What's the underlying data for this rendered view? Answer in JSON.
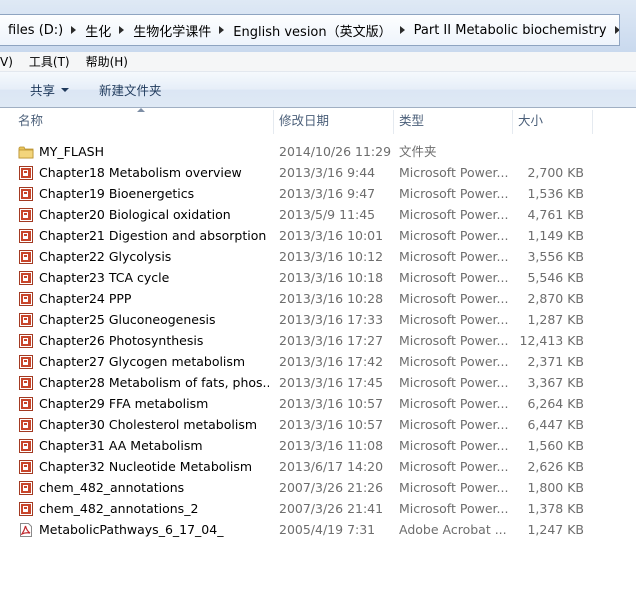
{
  "address_bar": {
    "crumbs": [
      "files (D:)",
      "生化",
      "生物化学课件",
      "English vesion（英文版）",
      "Part II Metabolic biochemistry"
    ]
  },
  "menu": {
    "items": [
      "V)",
      "工具(T)",
      "帮助(H)"
    ]
  },
  "commands": {
    "share_label": "共享",
    "new_folder_label": "新建文件夹"
  },
  "columns": {
    "name": "名称",
    "date": "修改日期",
    "type": "类型",
    "size": "大小"
  },
  "files": [
    {
      "icon": "folder-icon",
      "name": "MY_FLASH",
      "date": "2014/10/26 11:29",
      "type": "文件夹",
      "size": ""
    },
    {
      "icon": "powerpoint-icon",
      "name": "Chapter18 Metabolism overview",
      "date": "2013/3/16 9:44",
      "type": "Microsoft Power...",
      "size": "2,700 KB"
    },
    {
      "icon": "powerpoint-icon",
      "name": "Chapter19 Bioenergetics",
      "date": "2013/3/16 9:47",
      "type": "Microsoft Power...",
      "size": "1,536 KB"
    },
    {
      "icon": "powerpoint-icon",
      "name": "Chapter20 Biological oxidation",
      "date": "2013/5/9 11:45",
      "type": "Microsoft Power...",
      "size": "4,761 KB"
    },
    {
      "icon": "powerpoint-icon",
      "name": "Chapter21 Digestion and absorption ...",
      "date": "2013/3/16 10:01",
      "type": "Microsoft Power...",
      "size": "1,149 KB"
    },
    {
      "icon": "powerpoint-icon",
      "name": "Chapter22 Glycolysis",
      "date": "2013/3/16 10:12",
      "type": "Microsoft Power...",
      "size": "3,556 KB"
    },
    {
      "icon": "powerpoint-icon",
      "name": "Chapter23 TCA cycle",
      "date": "2013/3/16 10:18",
      "type": "Microsoft Power...",
      "size": "5,546 KB"
    },
    {
      "icon": "powerpoint-icon",
      "name": "Chapter24 PPP",
      "date": "2013/3/16 10:28",
      "type": "Microsoft Power...",
      "size": "2,870 KB"
    },
    {
      "icon": "powerpoint-icon",
      "name": "Chapter25 Gluconeogenesis",
      "date": "2013/3/16 17:33",
      "type": "Microsoft Power...",
      "size": "1,287 KB"
    },
    {
      "icon": "powerpoint-icon",
      "name": "Chapter26 Photosynthesis",
      "date": "2013/3/16 17:27",
      "type": "Microsoft Power...",
      "size": "12,413 KB"
    },
    {
      "icon": "powerpoint-icon",
      "name": "Chapter27 Glycogen metabolism",
      "date": "2013/3/16 17:42",
      "type": "Microsoft Power...",
      "size": "2,371 KB"
    },
    {
      "icon": "powerpoint-icon",
      "name": "Chapter28 Metabolism of fats, phos...",
      "date": "2013/3/16 17:45",
      "type": "Microsoft Power...",
      "size": "3,367 KB"
    },
    {
      "icon": "powerpoint-icon",
      "name": "Chapter29 FFA metabolism",
      "date": "2013/3/16 10:57",
      "type": "Microsoft Power...",
      "size": "6,264 KB"
    },
    {
      "icon": "powerpoint-icon",
      "name": "Chapter30 Cholesterol metabolism",
      "date": "2013/3/16 10:57",
      "type": "Microsoft Power...",
      "size": "6,447 KB"
    },
    {
      "icon": "powerpoint-icon",
      "name": "Chapter31 AA Metabolism",
      "date": "2013/3/16 11:08",
      "type": "Microsoft Power...",
      "size": "1,560 KB"
    },
    {
      "icon": "powerpoint-icon",
      "name": "Chapter32 Nucleotide Metabolism",
      "date": "2013/6/17 14:20",
      "type": "Microsoft Power...",
      "size": "2,626 KB"
    },
    {
      "icon": "powerpoint-icon",
      "name": "chem_482_annotations",
      "date": "2007/3/26 21:26",
      "type": "Microsoft Power...",
      "size": "1,800 KB"
    },
    {
      "icon": "powerpoint-icon",
      "name": "chem_482_annotations_2",
      "date": "2007/3/26 21:41",
      "type": "Microsoft Power...",
      "size": "1,378 KB"
    },
    {
      "icon": "pdf-icon",
      "name": "MetabolicPathways_6_17_04_",
      "date": "2005/4/19 7:31",
      "type": "Adobe Acrobat ...",
      "size": "1,247 KB"
    }
  ],
  "colors": {
    "folder": "#e8c35a",
    "powerpoint": "#c8452a",
    "pdf": "#c0272d"
  }
}
